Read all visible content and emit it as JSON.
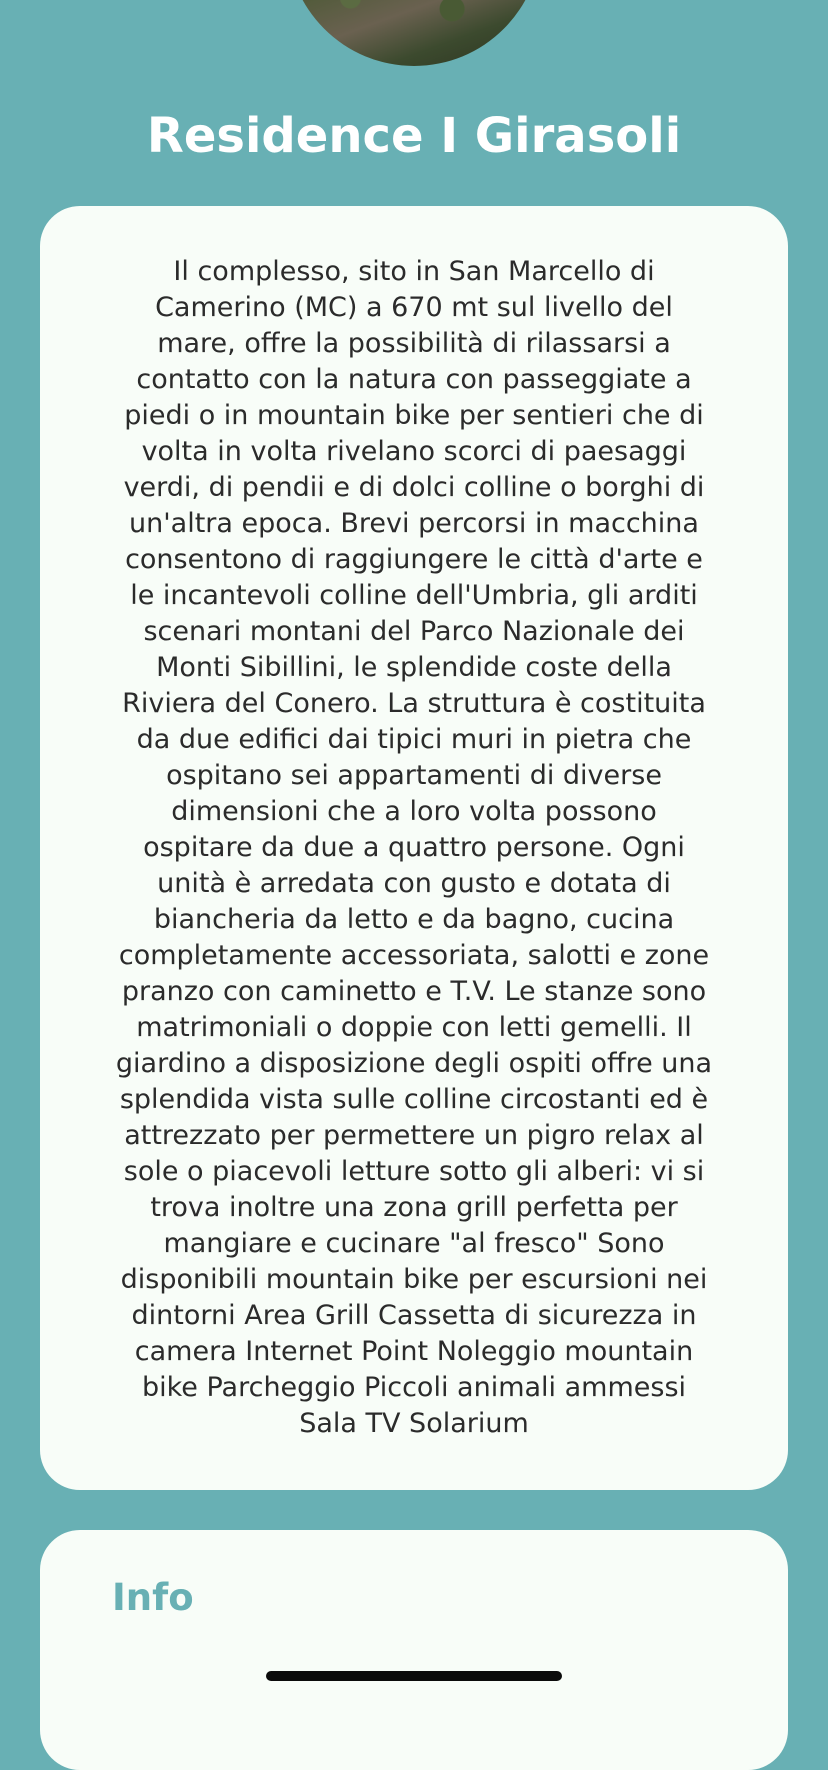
{
  "header": {
    "title": "Residence I Girasoli"
  },
  "description": {
    "text": "Il complesso, sito in San Marcello di Camerino (MC) a 670 mt sul livello del mare, offre la possibilità di rilassarsi a contatto con la natura con passeggiate a piedi o in mountain bike per sentieri che di volta in volta rivelano scorci di paesaggi verdi, di pendii e di dolci colline o borghi di un'altra epoca. Brevi percorsi in macchina consentono di raggiungere le città d'arte e le incantevoli colline dell'Umbria, gli arditi scenari montani del Parco Nazionale dei Monti Sibillini, le splendide coste della Riviera del Conero. La struttura è costituita da due edifici dai tipici muri in pietra che ospitano sei appartamenti di diverse dimensioni che a loro volta possono ospitare da due a quattro persone. Ogni unità è arredata con gusto e dotata di biancheria da letto e da bagno, cucina completamente accessoriata, salotti e zone pranzo con caminetto e T.V. Le stanze sono matrimoniali o doppie con letti gemelli. Il giardino a disposizione degli ospiti offre una splendida vista sulle colline circostanti ed è attrezzato per permettere un pigro relax al sole o piacevoli letture sotto gli alberi: vi si trova inoltre una zona grill perfetta per mangiare e cucinare \"al fresco\" Sono disponibili mountain bike per escursioni nei dintorni Area Grill Cassetta di sicurezza in camera Internet Point Noleggio mountain bike Parcheggio Piccoli animali ammessi Sala TV Solarium"
  },
  "info": {
    "heading": "Info"
  },
  "colors": {
    "background": "#68b0b4",
    "card": "#f8fdf8",
    "accent": "#68b0b4",
    "text": "#2b2b2b"
  }
}
